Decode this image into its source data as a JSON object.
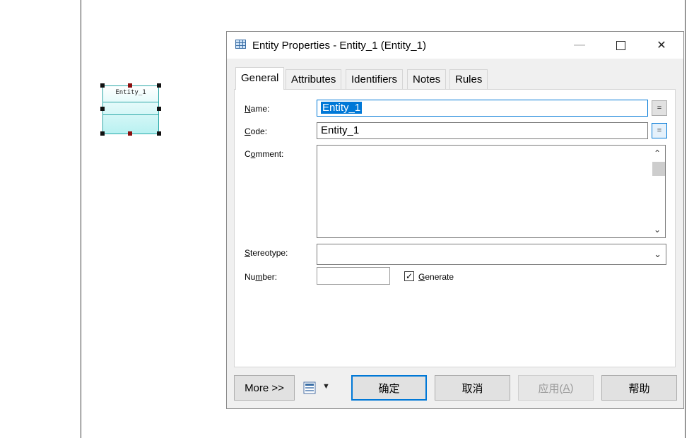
{
  "diagram": {
    "entity_name": "Entity_1",
    "entity_colors": {
      "border": "#2aa8a8",
      "fill": "#b9f1f1"
    }
  },
  "dialog": {
    "title": "Entity Properties - Entity_1 (Entity_1)",
    "window_buttons": {
      "minimize": "—",
      "maximize": "□",
      "close": "✕"
    },
    "tabs": [
      {
        "label": "General",
        "active": true
      },
      {
        "label": "Attributes",
        "active": false
      },
      {
        "label": "Identifiers",
        "active": false
      },
      {
        "label": "Notes",
        "active": false
      },
      {
        "label": "Rules",
        "active": false
      }
    ],
    "fields": {
      "name_label_prefix": "N",
      "name_label_rest": "ame:",
      "name_value": "Entity_1",
      "code_label_prefix": "C",
      "code_label_rest": "ode:",
      "code_value": "Entity_1",
      "comment_label_start": "C",
      "comment_label_underlined": "o",
      "comment_label_rest": "mment:",
      "stereotype_label_prefix": "S",
      "stereotype_label_rest": "tereotype:",
      "number_label_start": "Nu",
      "number_label_underlined": "m",
      "number_label_rest": "ber:",
      "number_value": "",
      "generate_label_prefix": "G",
      "generate_label_rest": "enerate",
      "generate_checked": true,
      "equals_symbol": "="
    },
    "buttons": {
      "more": "More >>",
      "ok": "确定",
      "cancel": "取消",
      "apply_main": "应用(",
      "apply_key": "A",
      "apply_end": ")",
      "help": "帮助"
    },
    "accent_color": "#0078d7"
  }
}
